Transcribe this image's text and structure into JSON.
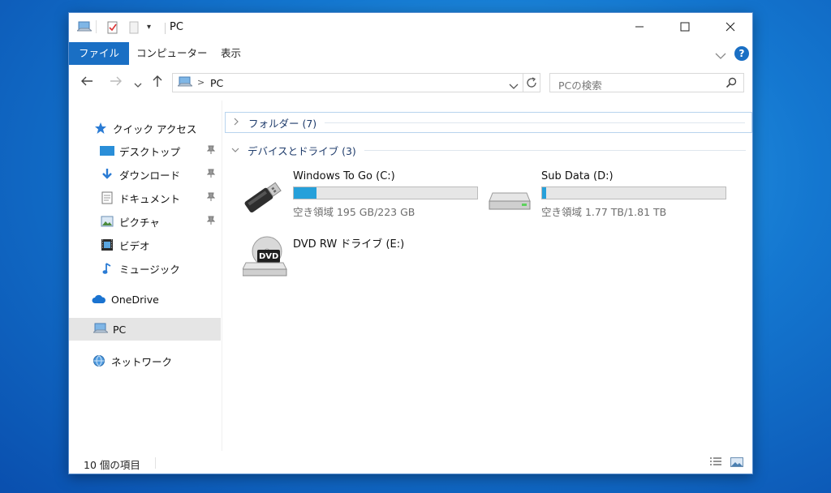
{
  "window": {
    "title": "PC",
    "controls": {
      "minimize": "—",
      "maximize": "☐",
      "close": "✕"
    }
  },
  "ribbon": {
    "tabs": [
      {
        "label": "ファイル",
        "active": true
      },
      {
        "label": "コンピューター",
        "active": false
      },
      {
        "label": "表示",
        "active": false
      }
    ],
    "help": "?"
  },
  "address": {
    "location": "PC",
    "separator": ">",
    "search_placeholder": "PCの検索"
  },
  "nav": {
    "quick_access": "クイック アクセス",
    "items": [
      {
        "label": "デスクトップ",
        "icon": "desktop-folder-icon",
        "pinned": true
      },
      {
        "label": "ダウンロード",
        "icon": "download-folder-icon",
        "pinned": true
      },
      {
        "label": "ドキュメント",
        "icon": "documents-folder-icon",
        "pinned": true
      },
      {
        "label": "ピクチャ",
        "icon": "pictures-folder-icon",
        "pinned": true
      },
      {
        "label": "ビデオ",
        "icon": "videos-folder-icon",
        "pinned": false
      },
      {
        "label": "ミュージック",
        "icon": "music-folder-icon",
        "pinned": false
      }
    ],
    "onedrive": "OneDrive",
    "pc": "PC",
    "network": "ネットワーク"
  },
  "content": {
    "folders_group": "フォルダー (7)",
    "devices_group": "デバイスとドライブ (3)",
    "drives": [
      {
        "name": "Windows To Go (C:)",
        "free_text": "空き領域 195 GB/223 GB",
        "used_fraction": 0.126,
        "icon": "usb-drive-icon"
      },
      {
        "name": "Sub Data (D:)",
        "free_text": "空き領域 1.77 TB/1.81 TB",
        "used_fraction": 0.022,
        "icon": "hard-drive-icon"
      },
      {
        "name": "DVD RW ドライブ (E:)",
        "icon": "dvd-drive-icon",
        "badge": "DVD"
      }
    ]
  },
  "status": {
    "item_count": "10 個の項目"
  },
  "colors": {
    "accent": "#1a6fc4",
    "bar_fill": "#26a0da",
    "selection": "#e5e5e5"
  }
}
